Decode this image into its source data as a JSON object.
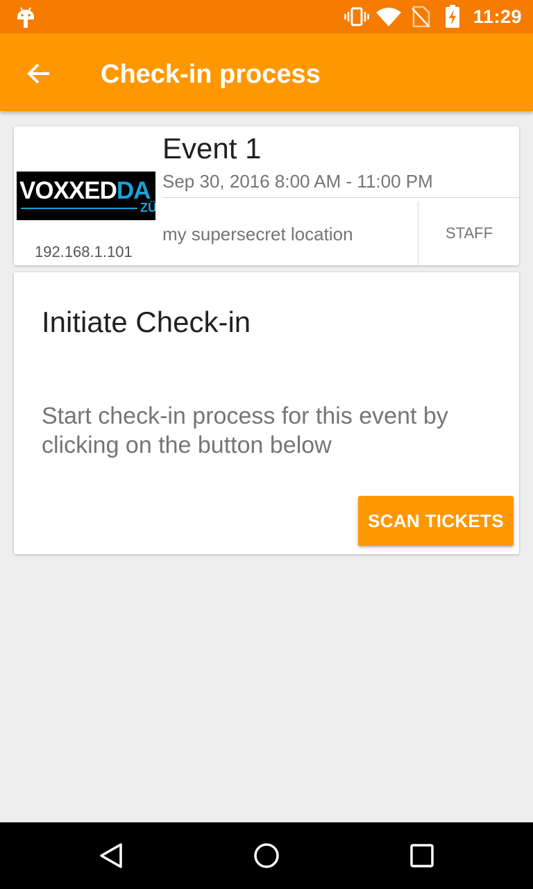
{
  "status_bar": {
    "time": "11:29",
    "icons": [
      "android-debug-icon",
      "vibrate-icon",
      "wifi-icon",
      "no-sim-icon",
      "battery-charging-icon"
    ]
  },
  "app_bar": {
    "title": "Check-in process",
    "back_icon": "arrow-left-icon"
  },
  "event": {
    "title": "Event 1",
    "date": "Sep 30, 2016 8:00 AM - 11:00 PM",
    "location": "my supersecret location",
    "role": "STAFF",
    "ip": "192.168.1.101",
    "logo": {
      "text_a": "VOXXED",
      "text_b": "DA",
      "sub": "ZÜ"
    }
  },
  "checkin": {
    "title": "Initiate Check-in",
    "description": "Start check-in process for this event by clicking on the button below",
    "button_label": "SCAN TICKETS"
  },
  "nav": {
    "icons": [
      "back-triangle-icon",
      "home-circle-icon",
      "recents-square-icon"
    ]
  },
  "colors": {
    "status_bar": "#f57c00",
    "app_bar": "#ff9800",
    "accent": "#ff9800",
    "background": "#eeeeee"
  }
}
